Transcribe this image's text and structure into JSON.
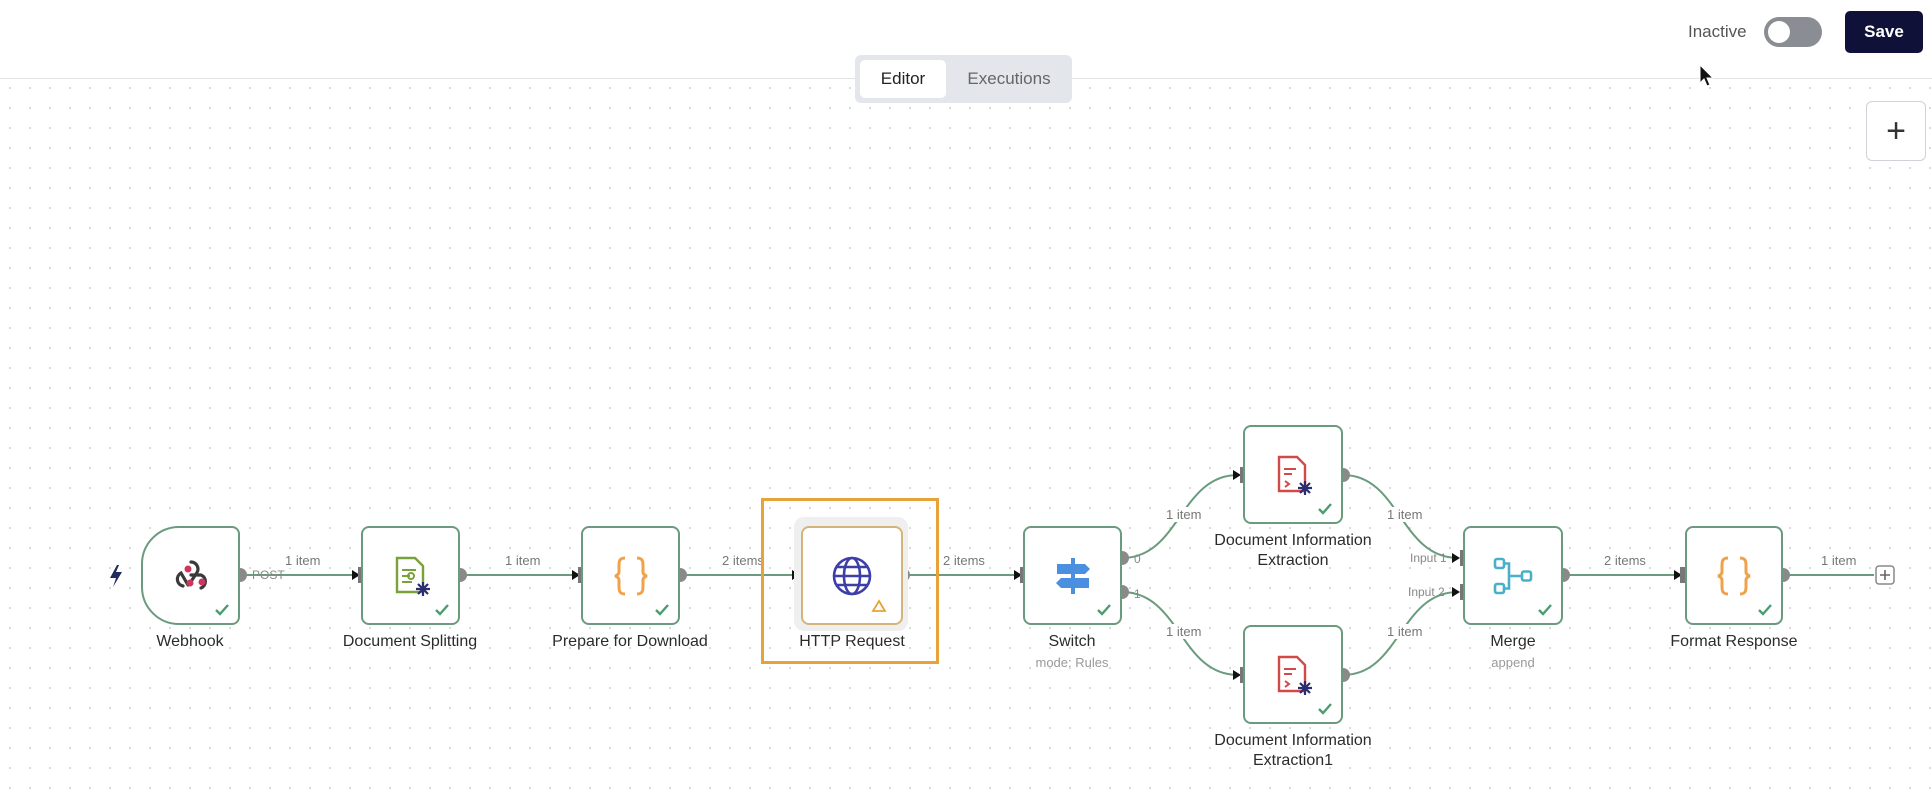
{
  "header": {
    "status_label": "Inactive",
    "save_label": "Save",
    "tabs": [
      {
        "label": "Editor"
      },
      {
        "label": "Executions"
      }
    ],
    "add_node_label": "+"
  },
  "colors": {
    "node_border": "#6a9b7d",
    "edge": "#6a9b7d",
    "selection": "#e8a23a",
    "save": "#101138"
  },
  "nodes": [
    {
      "id": "webhook",
      "label": "Webhook",
      "icon": "webhook-icon"
    },
    {
      "id": "split",
      "label": "Document Splitting",
      "icon": "document-split-icon"
    },
    {
      "id": "prepare",
      "label": "Prepare for Download",
      "icon": "code-braces-icon"
    },
    {
      "id": "http",
      "label": "HTTP Request",
      "icon": "globe-icon"
    },
    {
      "id": "switch",
      "label": "Switch",
      "sub": "mode: Rules",
      "icon": "signpost-icon"
    },
    {
      "id": "extract",
      "label": "Document Information Extraction",
      "icon": "pdf-extract-icon"
    },
    {
      "id": "extract1",
      "label": "Document Information Extraction1",
      "icon": "pdf-extract-icon"
    },
    {
      "id": "merge",
      "label": "Merge",
      "sub": "append",
      "icon": "merge-icon"
    },
    {
      "id": "format",
      "label": "Format Response",
      "icon": "code-braces-icon"
    }
  ],
  "edges": [
    {
      "label": "1 item"
    },
    {
      "label": "1 item"
    },
    {
      "label": "2 items"
    },
    {
      "label": "2 items"
    },
    {
      "label": "1 item"
    },
    {
      "label": "1 item"
    },
    {
      "label": "1 item"
    },
    {
      "label": "1 item"
    },
    {
      "label": "2 items"
    },
    {
      "label": "1 item"
    }
  ],
  "port_labels": {
    "webhook_out": "POST",
    "switch_out0": "0",
    "switch_out1": "1",
    "merge_in1": "Input 1",
    "merge_in2": "Input 2"
  }
}
